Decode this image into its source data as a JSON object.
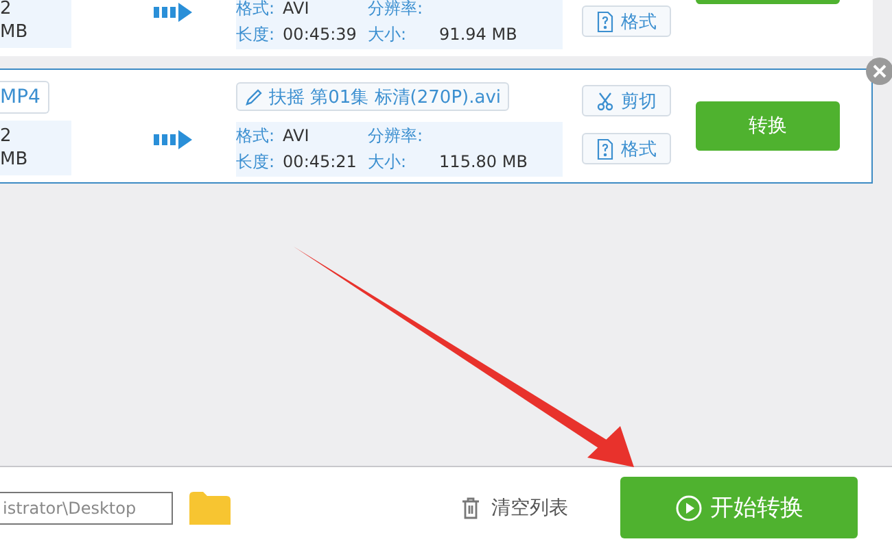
{
  "items": [
    {
      "selected": false,
      "source_lines": [
        "2",
        "MB"
      ],
      "info": [
        {
          "label": "格式:",
          "value": "AVI"
        },
        {
          "label": "分辨率:"
        },
        {
          "label": "长度:",
          "value": "00:45:39"
        },
        {
          "label": "大小:",
          "value": "91.94 MB"
        }
      ],
      "tools": [
        {
          "kind": "format",
          "label": "格式"
        }
      ]
    },
    {
      "selected": true,
      "output_tag": "MP4",
      "source_lines": [
        "2",
        "MB"
      ],
      "file_name": "扶摇 第01集 标清(270P).avi",
      "info": [
        {
          "label": "格式:",
          "value": "AVI"
        },
        {
          "label": "分辨率:"
        },
        {
          "label": "长度:",
          "value": "00:45:21"
        },
        {
          "label": "大小:",
          "value": "115.80 MB"
        }
      ],
      "tools": [
        {
          "kind": "cut",
          "label": "剪切"
        },
        {
          "kind": "format",
          "label": "格式"
        }
      ],
      "convert_label": "转换"
    }
  ],
  "footer": {
    "path_value": "istrator\\Desktop",
    "clear_label": "清空列表",
    "start_label": "开始转换"
  },
  "annotation": {
    "kind": "arrow"
  }
}
